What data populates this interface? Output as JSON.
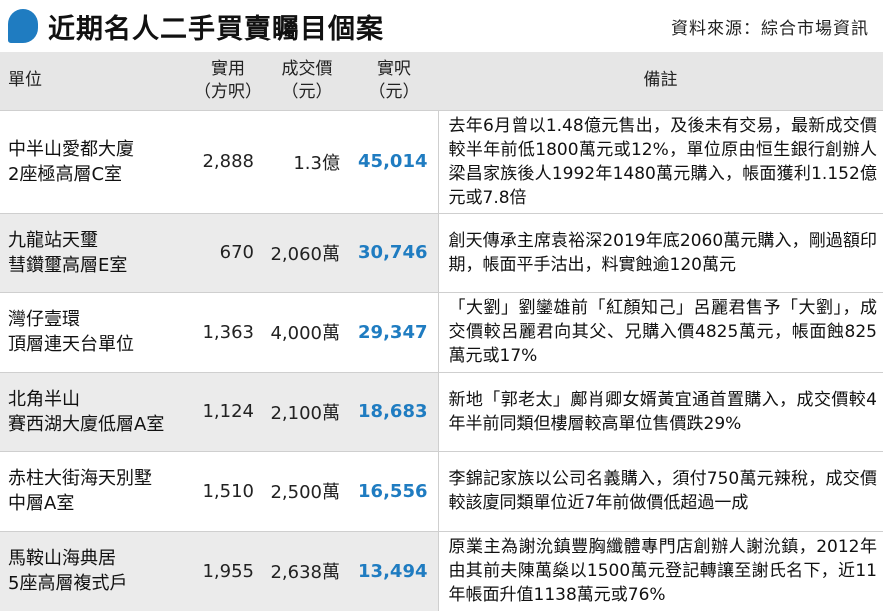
{
  "header": {
    "title": "近期名人二手買賣矚目個案",
    "source": "資料來源：綜合市場資訊"
  },
  "columns": {
    "unit": "單位",
    "area_1": "實用",
    "area_2": "（方呎）",
    "price_1": "成交價",
    "price_2": "（元）",
    "ppsf_1": "實呎",
    "ppsf_2": "（元）",
    "note": "備註"
  },
  "rows": [
    {
      "unit_1": "中半山愛都大廈",
      "unit_2": "2座極高層C室",
      "area": "2,888",
      "price": "1.3億",
      "ppsf": "45,014",
      "note": "去年6月曾以1.48億元售出，及後未有交易，最新成交價較半年前低1800萬元或12%，單位原由恒生銀行創辦人梁昌家族後人1992年1480萬元購入，帳面獲利1.152億元或7.8倍"
    },
    {
      "unit_1": "九龍站天璽",
      "unit_2": "彗鑽璽高層E室",
      "area": "670",
      "price": "2,060萬",
      "ppsf": "30,746",
      "note": "創天傳承主席袁裕深2019年底2060萬元購入，剛過額印期，帳面平手沽出，料實蝕逾120萬元"
    },
    {
      "unit_1": "灣仔壹環",
      "unit_2": "頂層連天台單位",
      "area": "1,363",
      "price": "4,000萬",
      "ppsf": "29,347",
      "note": "「大劉」劉鑾雄前「紅顏知己」呂麗君售予「大劉」，成交價較呂麗君向其父、兄購入價4825萬元，帳面蝕825萬元或17%"
    },
    {
      "unit_1": "北角半山",
      "unit_2": "賽西湖大廈低層A室",
      "area": "1,124",
      "price": "2,100萬",
      "ppsf": "18,683",
      "note": "新地「郭老太」鄺肖卿女婿黃宜通首置購入，成交價較4年半前同類但樓層較高單位售價跌29%"
    },
    {
      "unit_1": "赤柱大街海天別墅",
      "unit_2": "中層A室",
      "area": "1,510",
      "price": "2,500萬",
      "ppsf": "16,556",
      "note": "李錦記家族以公司名義購入，須付750萬元辣稅，成交價較該廈同類單位近7年前做價低超過一成"
    },
    {
      "unit_1": "馬鞍山海典居",
      "unit_2": "5座高層複式戶",
      "area": "1,955",
      "price": "2,638萬",
      "ppsf": "13,494",
      "note": "原業主為謝沇鎮豐胸纖體專門店創辦人謝沇鎮，2012年由其前夫陳萬燊以1500萬元登記轉讓至謝氏名下，近11年帳面升值1138萬元或76%"
    }
  ],
  "colors": {
    "accent": "#1f7cc1",
    "header_bg": "#e6e6e6",
    "stripe_bg": "#ebebeb"
  }
}
